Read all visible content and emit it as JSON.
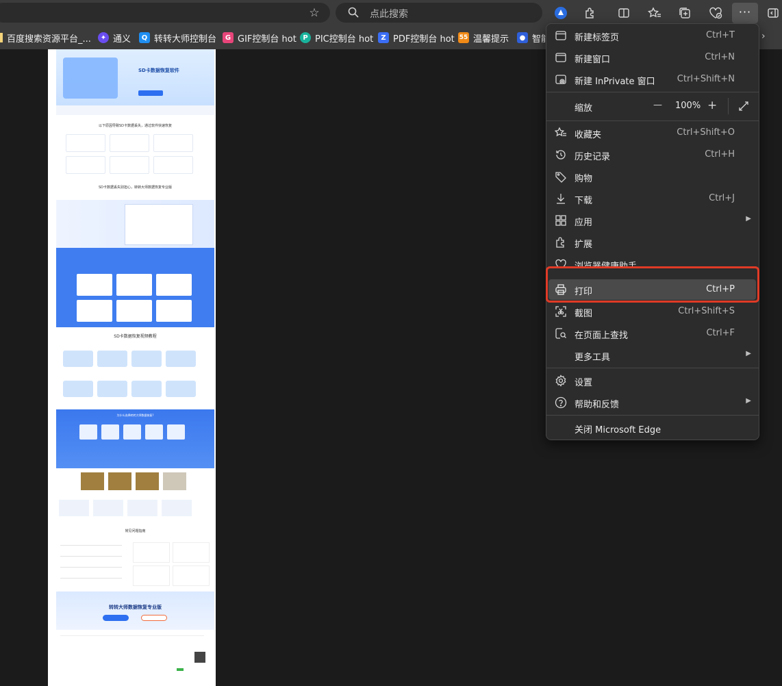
{
  "toolbar": {
    "search_placeholder": "点此搜索",
    "more_label": "···"
  },
  "bookmarks": [
    {
      "label": "百度搜索资源平台_...",
      "color": "#2c63e8",
      "glyph": "百"
    },
    {
      "label": "通义",
      "color": "#6a4df0",
      "glyph": "✦"
    },
    {
      "label": "转转大师控制台",
      "color": "#1f8ef1",
      "glyph": "Q"
    },
    {
      "label": "GIF控制台 hot",
      "color": "#e8457a",
      "glyph": "G"
    },
    {
      "label": "PIC控制台 hot",
      "color": "#19b39c",
      "glyph": "P"
    },
    {
      "label": "PDF控制台 hot",
      "color": "#3b6ef5",
      "glyph": "Z"
    },
    {
      "label": "温馨提示",
      "color": "#f08a17",
      "glyph": "55"
    },
    {
      "label": "智能",
      "color": "#2f5fd9",
      "glyph": "🐾"
    }
  ],
  "menu": {
    "new_tab": {
      "label": "新建标签页",
      "shortcut": "Ctrl+T"
    },
    "new_window": {
      "label": "新建窗口",
      "shortcut": "Ctrl+N"
    },
    "new_inprivate": {
      "label": "新建 InPrivate 窗口",
      "shortcut": "Ctrl+Shift+N"
    },
    "zoom": {
      "label": "缩放",
      "minus": "—",
      "value": "100%",
      "plus": "+"
    },
    "favorites": {
      "label": "收藏夹",
      "shortcut": "Ctrl+Shift+O"
    },
    "history": {
      "label": "历史记录",
      "shortcut": "Ctrl+H"
    },
    "shopping": {
      "label": "购物"
    },
    "downloads": {
      "label": "下载",
      "shortcut": "Ctrl+J"
    },
    "apps": {
      "label": "应用"
    },
    "extensions": {
      "label": "扩展"
    },
    "browser_essentials": {
      "label": "浏览器健康助手"
    },
    "print": {
      "label": "打印",
      "shortcut": "Ctrl+P"
    },
    "screenshot": {
      "label": "截图",
      "shortcut": "Ctrl+Shift+S"
    },
    "find": {
      "label": "在页面上查找",
      "shortcut": "Ctrl+F"
    },
    "more_tools": {
      "label": "更多工具"
    },
    "settings": {
      "label": "设置"
    },
    "help": {
      "label": "帮助和反馈"
    },
    "close": {
      "label": "关闭 Microsoft Edge"
    }
  },
  "page_preview": {
    "hero_title": "SD卡数据恢复软件",
    "section1_title": "以下原因导致SD卡数据丢失，通过软件快速恢复",
    "section2_title": "SD卡数据丢失别担心，转转大师数据恢复专业版",
    "section3_title": "SD卡数据恢复视频教程",
    "section4_title": "为什么选择转转大师数据恢复?",
    "section5_title": "常见问题指南",
    "banner_title": "转转大师数据恢复专业版"
  },
  "colors": {
    "highlight_border": "#e03a26",
    "menu_bg": "#2c2c2c",
    "page_blue": "#3f7df0"
  }
}
